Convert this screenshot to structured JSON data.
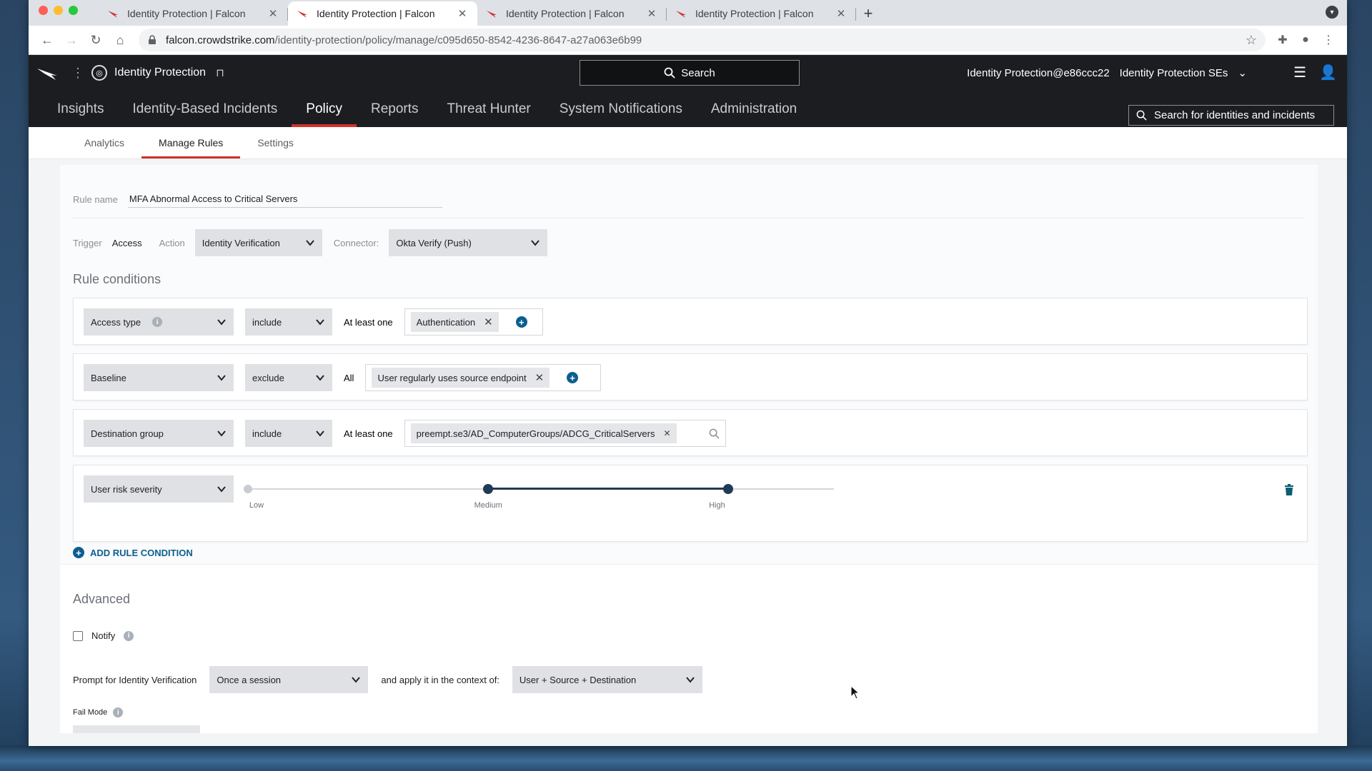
{
  "browser": {
    "tabs": [
      {
        "title": "Identity Protection | Falcon",
        "active": false
      },
      {
        "title": "Identity Protection | Falcon",
        "active": true
      },
      {
        "title": "Identity Protection | Falcon",
        "active": false
      },
      {
        "title": "Identity Protection | Falcon",
        "active": false
      }
    ],
    "url_host": "falcon.crowdstrike.com",
    "url_path": "/identity-protection/policy/manage/c095d650-8542-4236-8647-a27a063e6b99"
  },
  "app": {
    "product_name": "Identity Protection",
    "search_label": "Search",
    "account_user": "Identity Protection@e86ccc22",
    "account_org": "Identity Protection SEs",
    "nav": [
      "Insights",
      "Identity-Based Incidents",
      "Policy",
      "Reports",
      "Threat Hunter",
      "System Notifications",
      "Administration"
    ],
    "nav_active": "Policy",
    "entity_search_placeholder": "Search for identities and incidents"
  },
  "subnav": {
    "items": [
      "Analytics",
      "Manage Rules",
      "Settings"
    ],
    "active": "Manage Rules"
  },
  "rule": {
    "name_label": "Rule name",
    "name_value": "MFA Abnormal Access to Critical Servers",
    "trigger_label": "Trigger",
    "trigger_value": "Access",
    "action_label": "Action",
    "action_value": "Identity Verification",
    "connector_label": "Connector:",
    "connector_value": "Okta Verify (Push)"
  },
  "conditions": {
    "title": "Rule conditions",
    "rows": [
      {
        "field": "Access type",
        "operator": "include",
        "quantifier": "At least one",
        "value": "Authentication"
      },
      {
        "field": "Baseline",
        "operator": "exclude",
        "quantifier": "All",
        "value": "User regularly uses source endpoint"
      },
      {
        "field": "Destination group",
        "operator": "include",
        "quantifier": "At least one",
        "value": "preempt.se3/AD_ComputerGroups/ADCG_CriticalServers"
      }
    ],
    "risk": {
      "field": "User risk severity",
      "levels": [
        "Low",
        "Medium",
        "High"
      ],
      "selected_range": [
        "Medium",
        "High"
      ]
    },
    "add_label": "ADD RULE CONDITION"
  },
  "advanced": {
    "title": "Advanced",
    "notify_label": "Notify",
    "notify_checked": false,
    "prompt_label": "Prompt for Identity Verification",
    "prompt_value": "Once a session",
    "context_label": "and apply it in the context of:",
    "context_value": "User + Source + Destination",
    "fail_mode_label": "Fail Mode"
  },
  "colors": {
    "accent_red": "#d0312d",
    "link_blue": "#0b5f8f",
    "slider_dark": "#1f3b55",
    "header_bg": "#1b1d21"
  }
}
